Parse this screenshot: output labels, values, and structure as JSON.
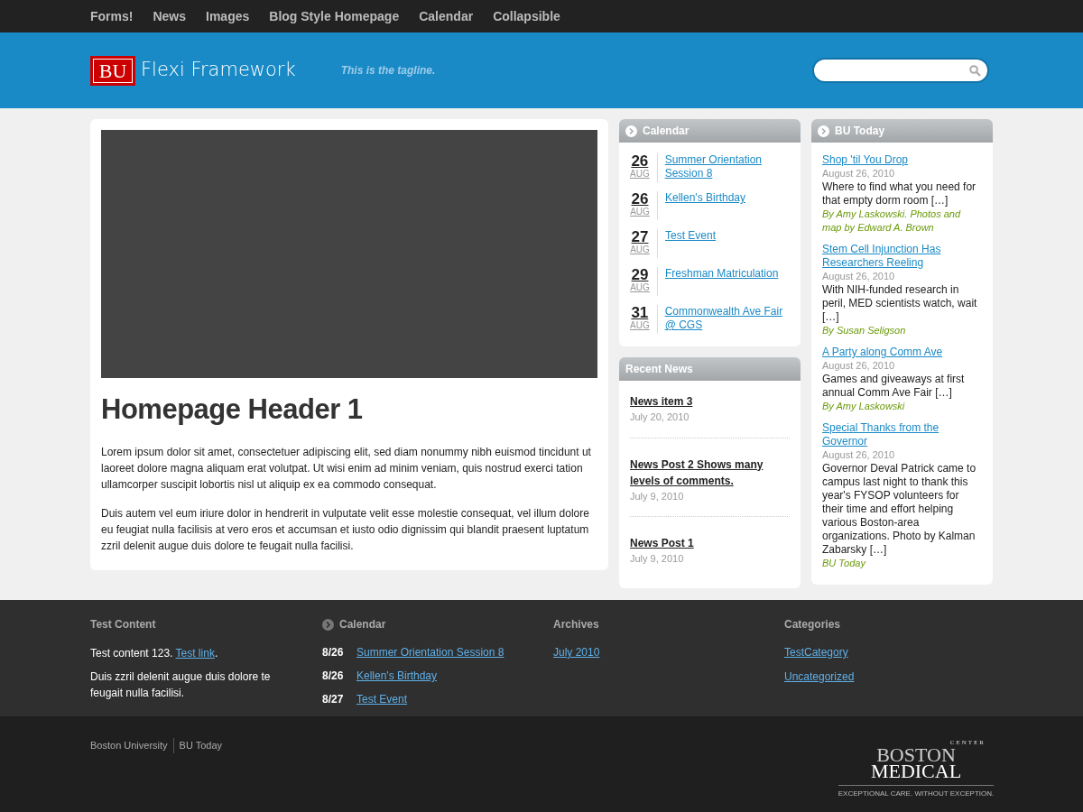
{
  "nav": [
    {
      "label": "Forms!"
    },
    {
      "label": "News"
    },
    {
      "label": "Images"
    },
    {
      "label": "Blog Style Homepage"
    },
    {
      "label": "Calendar"
    },
    {
      "label": "Collapsible"
    }
  ],
  "header": {
    "logo_mark": "BU",
    "site_title": "Flexi Framework",
    "tagline": "This is the tagline."
  },
  "main": {
    "heading": "Homepage Header 1",
    "paragraphs": [
      "Lorem ipsum dolor sit amet, consectetuer adipiscing elit, sed diam nonummy nibh euismod tincidunt ut laoreet dolore magna aliquam erat volutpat. Ut wisi enim ad minim veniam, quis nostrud exerci tation ullamcorper suscipit lobortis nisl ut aliquip ex ea commodo consequat.",
      "Duis autem vel eum iriure dolor in hendrerit in vulputate velit esse molestie consequat, vel illum dolore eu feugiat nulla facilisis at vero eros et accumsan et iusto odio dignissim qui blandit praesent luptatum zzril delenit augue duis dolore te feugait nulla facilisi."
    ]
  },
  "calendar": {
    "title": "Calendar",
    "events": [
      {
        "day": "26",
        "month": "AUG",
        "title": "Summer Orientation Session 8"
      },
      {
        "day": "26",
        "month": "AUG",
        "title": "Kellen's Birthday"
      },
      {
        "day": "27",
        "month": "AUG",
        "title": "Test Event"
      },
      {
        "day": "29",
        "month": "AUG",
        "title": "Freshman Matriculation"
      },
      {
        "day": "31",
        "month": "AUG",
        "title": "Commonwealth Ave Fair @ CGS"
      }
    ]
  },
  "recent_news": {
    "title": "Recent News",
    "items": [
      {
        "title": "News item 3",
        "date": "July 20, 2010"
      },
      {
        "title": "News Post 2 Shows many levels of comments.",
        "date": "July 9, 2010"
      },
      {
        "title": "News Post 1",
        "date": "July 9, 2010"
      }
    ]
  },
  "bu_today": {
    "title": "BU Today",
    "stories": [
      {
        "title": "Shop 'til You Drop",
        "date": "August 26, 2010",
        "summary": "Where to find what you need for that empty dorm room […]",
        "byline": "By Amy Laskowski. Photos and map by Edward A. Brown"
      },
      {
        "title": "Stem Cell Injunction Has Researchers Reeling",
        "date": "August 26, 2010",
        "summary": "With NIH-funded research in peril, MED scientists watch, wait […]",
        "byline": "By Susan Seligson"
      },
      {
        "title": "A Party along Comm Ave",
        "date": "August 26, 2010",
        "summary": "Games and giveaways at first annual Comm Ave Fair […]",
        "byline": "By Amy Laskowski"
      },
      {
        "title": "Special Thanks from the Governor",
        "date": "August 26, 2010",
        "summary": "Governor Deval Patrick came to campus last night to thank this year's FYSOP volunteers for their time and effort helping various Boston-area organizations. Photo by Kalman Zabarsky […]",
        "byline": "BU Today"
      }
    ]
  },
  "footer": {
    "test_content": {
      "title": "Test Content",
      "text": "Test content 123.",
      "link": "Test link",
      "end": ".",
      "paragraph": "Duis zzril delenit augue duis dolore te feugait nulla facilisi."
    },
    "calendar": {
      "title": "Calendar",
      "events": [
        {
          "date": "8/26",
          "title": "Summer Orientation Session 8"
        },
        {
          "date": "8/26",
          "title": "Kellen's Birthday"
        },
        {
          "date": "8/27",
          "title": "Test Event"
        }
      ]
    },
    "archives": {
      "title": "Archives",
      "links": [
        "July 2010"
      ]
    },
    "categories": {
      "title": "Categories",
      "links": [
        "TestCategory",
        "Uncategorized"
      ]
    }
  },
  "bottom": {
    "links": [
      "Boston University",
      "BU Today"
    ],
    "logo": {
      "word1": "BOSTON",
      "word2": "MEDICAL",
      "arc": "CENTER",
      "slogan": "EXCEPTIONAL CARE. WITHOUT EXCEPTION."
    }
  }
}
